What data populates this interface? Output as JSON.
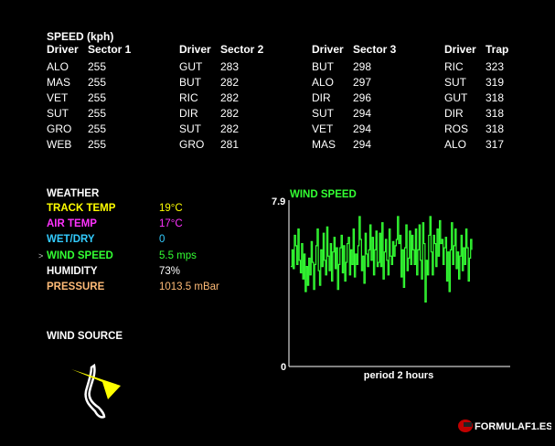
{
  "speed": {
    "title": "SPEED (kph)",
    "tables": [
      {
        "col1": "Driver",
        "col2": "Sector 1",
        "rows": [
          [
            "ALO",
            "255"
          ],
          [
            "MAS",
            "255"
          ],
          [
            "VET",
            "255"
          ],
          [
            "SUT",
            "255"
          ],
          [
            "GRO",
            "255"
          ],
          [
            "WEB",
            "255"
          ]
        ]
      },
      {
        "col1": "Driver",
        "col2": "Sector 2",
        "rows": [
          [
            "GUT",
            "283"
          ],
          [
            "BUT",
            "282"
          ],
          [
            "RIC",
            "282"
          ],
          [
            "DIR",
            "282"
          ],
          [
            "SUT",
            "282"
          ],
          [
            "GRO",
            "281"
          ]
        ]
      },
      {
        "col1": "Driver",
        "col2": "Sector 3",
        "rows": [
          [
            "BUT",
            "298"
          ],
          [
            "ALO",
            "297"
          ],
          [
            "DIR",
            "296"
          ],
          [
            "SUT",
            "294"
          ],
          [
            "VET",
            "294"
          ],
          [
            "MAS",
            "294"
          ]
        ]
      },
      {
        "col1": "Driver",
        "col2": "Trap",
        "rows": [
          [
            "RIC",
            "323"
          ],
          [
            "SUT",
            "319"
          ],
          [
            "GUT",
            "318"
          ],
          [
            "DIR",
            "318"
          ],
          [
            "ROS",
            "318"
          ],
          [
            "ALO",
            "317"
          ]
        ]
      }
    ]
  },
  "weather": {
    "title": "WEATHER",
    "items": [
      {
        "label": "TRACK TEMP",
        "value": "19°C",
        "label_color": "#ffff00",
        "value_color": "#ffff00",
        "selected": false
      },
      {
        "label": "AIR TEMP",
        "value": "17°C",
        "label_color": "#ff33ff",
        "value_color": "#ff33ff",
        "selected": false
      },
      {
        "label": "WET/DRY",
        "value": "0",
        "label_color": "#33ccff",
        "value_color": "#33ccff",
        "selected": false
      },
      {
        "label": "WIND SPEED",
        "value": "5.5 mps",
        "label_color": "#33ff33",
        "value_color": "#33ff33",
        "selected": true
      },
      {
        "label": "HUMIDITY",
        "value": "73%",
        "label_color": "#ffffff",
        "value_color": "#ffffff",
        "selected": false
      },
      {
        "label": "PRESSURE",
        "value": "1013.5 mBar",
        "label_color": "#ffbb77",
        "value_color": "#ffbb77",
        "selected": false
      }
    ],
    "selected_marker": ">"
  },
  "wind_source": {
    "title": "WIND SOURCE",
    "arrow_color": "#ffff00",
    "track_color": "#ffffff"
  },
  "chart_data": {
    "type": "line",
    "title": "WIND SPEED",
    "xlabel": "period 2 hours",
    "ylabel": "",
    "ylim": [
      0,
      7.9
    ],
    "y_ticks": [
      "7.9",
      "0"
    ],
    "line_color": "#33ff33",
    "grid": false,
    "series": [
      {
        "values": [
          4.8,
          5.6,
          4.7,
          6.3,
          5.8,
          4.9,
          6.6,
          5.1,
          4.5,
          5.9,
          4.2,
          5.4,
          3.6,
          4.8,
          3.9,
          5.2,
          4.4,
          6.0,
          5.0,
          3.7,
          4.9,
          5.8,
          6.6,
          4.6,
          3.9,
          5.6,
          4.8,
          6.4,
          5.1,
          4.4,
          6.7,
          5.3,
          4.6,
          5.9,
          4.1,
          5.5,
          6.2,
          4.7,
          5.7,
          3.7,
          4.9,
          5.7,
          6.3,
          4.5,
          5.8,
          4.1,
          5.0,
          5.9,
          6.2,
          4.4,
          5.6,
          4.9,
          6.6,
          4.3,
          5.4,
          4.9,
          5.8,
          7.2,
          6.1,
          4.6,
          5.3,
          4.0,
          6.4,
          5.4,
          4.8,
          5.6,
          6.8,
          5.1,
          6.2,
          4.4,
          5.6,
          6.5,
          4.8,
          5.0,
          6.4,
          4.8,
          6.9,
          4.2,
          5.5,
          6.1,
          5.1,
          4.4,
          6.6,
          5.3,
          4.9,
          6.0,
          5.3,
          5.8,
          6.1,
          7.2,
          5.9,
          6.3,
          4.3,
          5.6,
          3.8,
          5.7,
          6.8,
          4.6,
          5.2,
          6.5,
          4.9,
          6.3,
          5.6,
          4.9,
          6.6,
          4.4,
          5.6,
          6.8,
          5.1,
          4.2,
          6.9,
          5.9,
          3.1,
          5.1,
          4.4,
          6.3,
          7.2,
          5.5,
          4.4,
          6.3,
          5.9,
          4.8,
          6.6,
          5.3,
          7.0,
          5.9,
          6.1,
          4.9,
          5.7,
          6.2,
          4.1,
          5.5,
          3.6,
          5.6,
          6.9,
          4.9,
          5.8,
          6.6,
          4.7,
          5.5,
          4.2,
          5.3,
          6.3,
          4.6,
          5.7,
          4.9,
          6.6,
          5.7,
          4.1,
          5.2,
          6.1,
          5.6
        ]
      }
    ]
  },
  "logo": {
    "text": "FORMULAF1.ES"
  }
}
